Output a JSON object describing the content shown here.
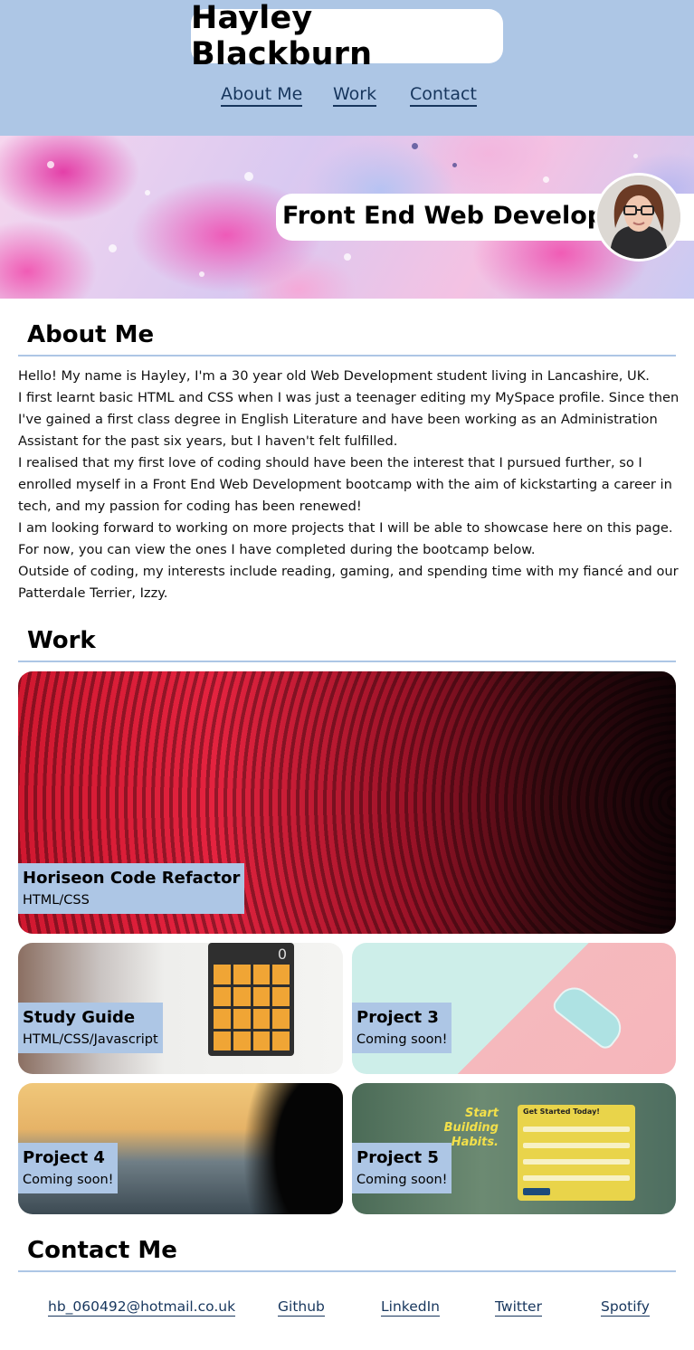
{
  "header": {
    "name": "Hayley Blackburn",
    "nav": [
      "About Me",
      "Work",
      "Contact"
    ]
  },
  "hero": {
    "tagline": "Front End Web Developer"
  },
  "about": {
    "title": "About Me",
    "lines": [
      "Hello! My name is Hayley, I'm a 30 year old Web Development student living in Lancashire, UK.",
      "I first learnt basic HTML and CSS when I was just a teenager editing my MySpace profile. Since then",
      "I've gained a first class degree in English Literature and have been working as an Administration",
      "Assistant for the past six years, but I haven't felt fulfilled.",
      "I realised that my first love of coding should have been the interest that I pursued further, so I",
      "enrolled myself in a Front End Web Development bootcamp with the aim of kickstarting a career in",
      "tech, and my passion for coding has been renewed!",
      "I am looking forward to working on more projects that I will be able to showcase here on this page.",
      "For now, you can view the ones I have completed during the bootcamp below.",
      "Outside of coding, my interests include reading, gaming, and spending time with my fiancé and our",
      "Patterdale Terrier, Izzy."
    ]
  },
  "work": {
    "title": "Work",
    "projects": [
      {
        "title": "Horiseon Code Refactor",
        "sub": "HTML/CSS"
      },
      {
        "title": "Study Guide",
        "sub": "HTML/CSS/Javascript"
      },
      {
        "title": "Project 3",
        "sub": "Coming soon!"
      },
      {
        "title": "Project 4",
        "sub": "Coming soon!"
      },
      {
        "title": "Project 5",
        "sub": "Coming soon!"
      }
    ],
    "thumb_text": {
      "calculator_display": "0",
      "habits_heading": "Start Building Habits.",
      "form_heading": "Get Started Today!"
    }
  },
  "contact": {
    "title": "Contact Me",
    "links": [
      "hb_060492@hotmail.co.uk",
      "Github",
      "LinkedIn",
      "Twitter",
      "Spotify"
    ]
  },
  "colors": {
    "accent": "#adc6e5",
    "link": "#17365d"
  }
}
